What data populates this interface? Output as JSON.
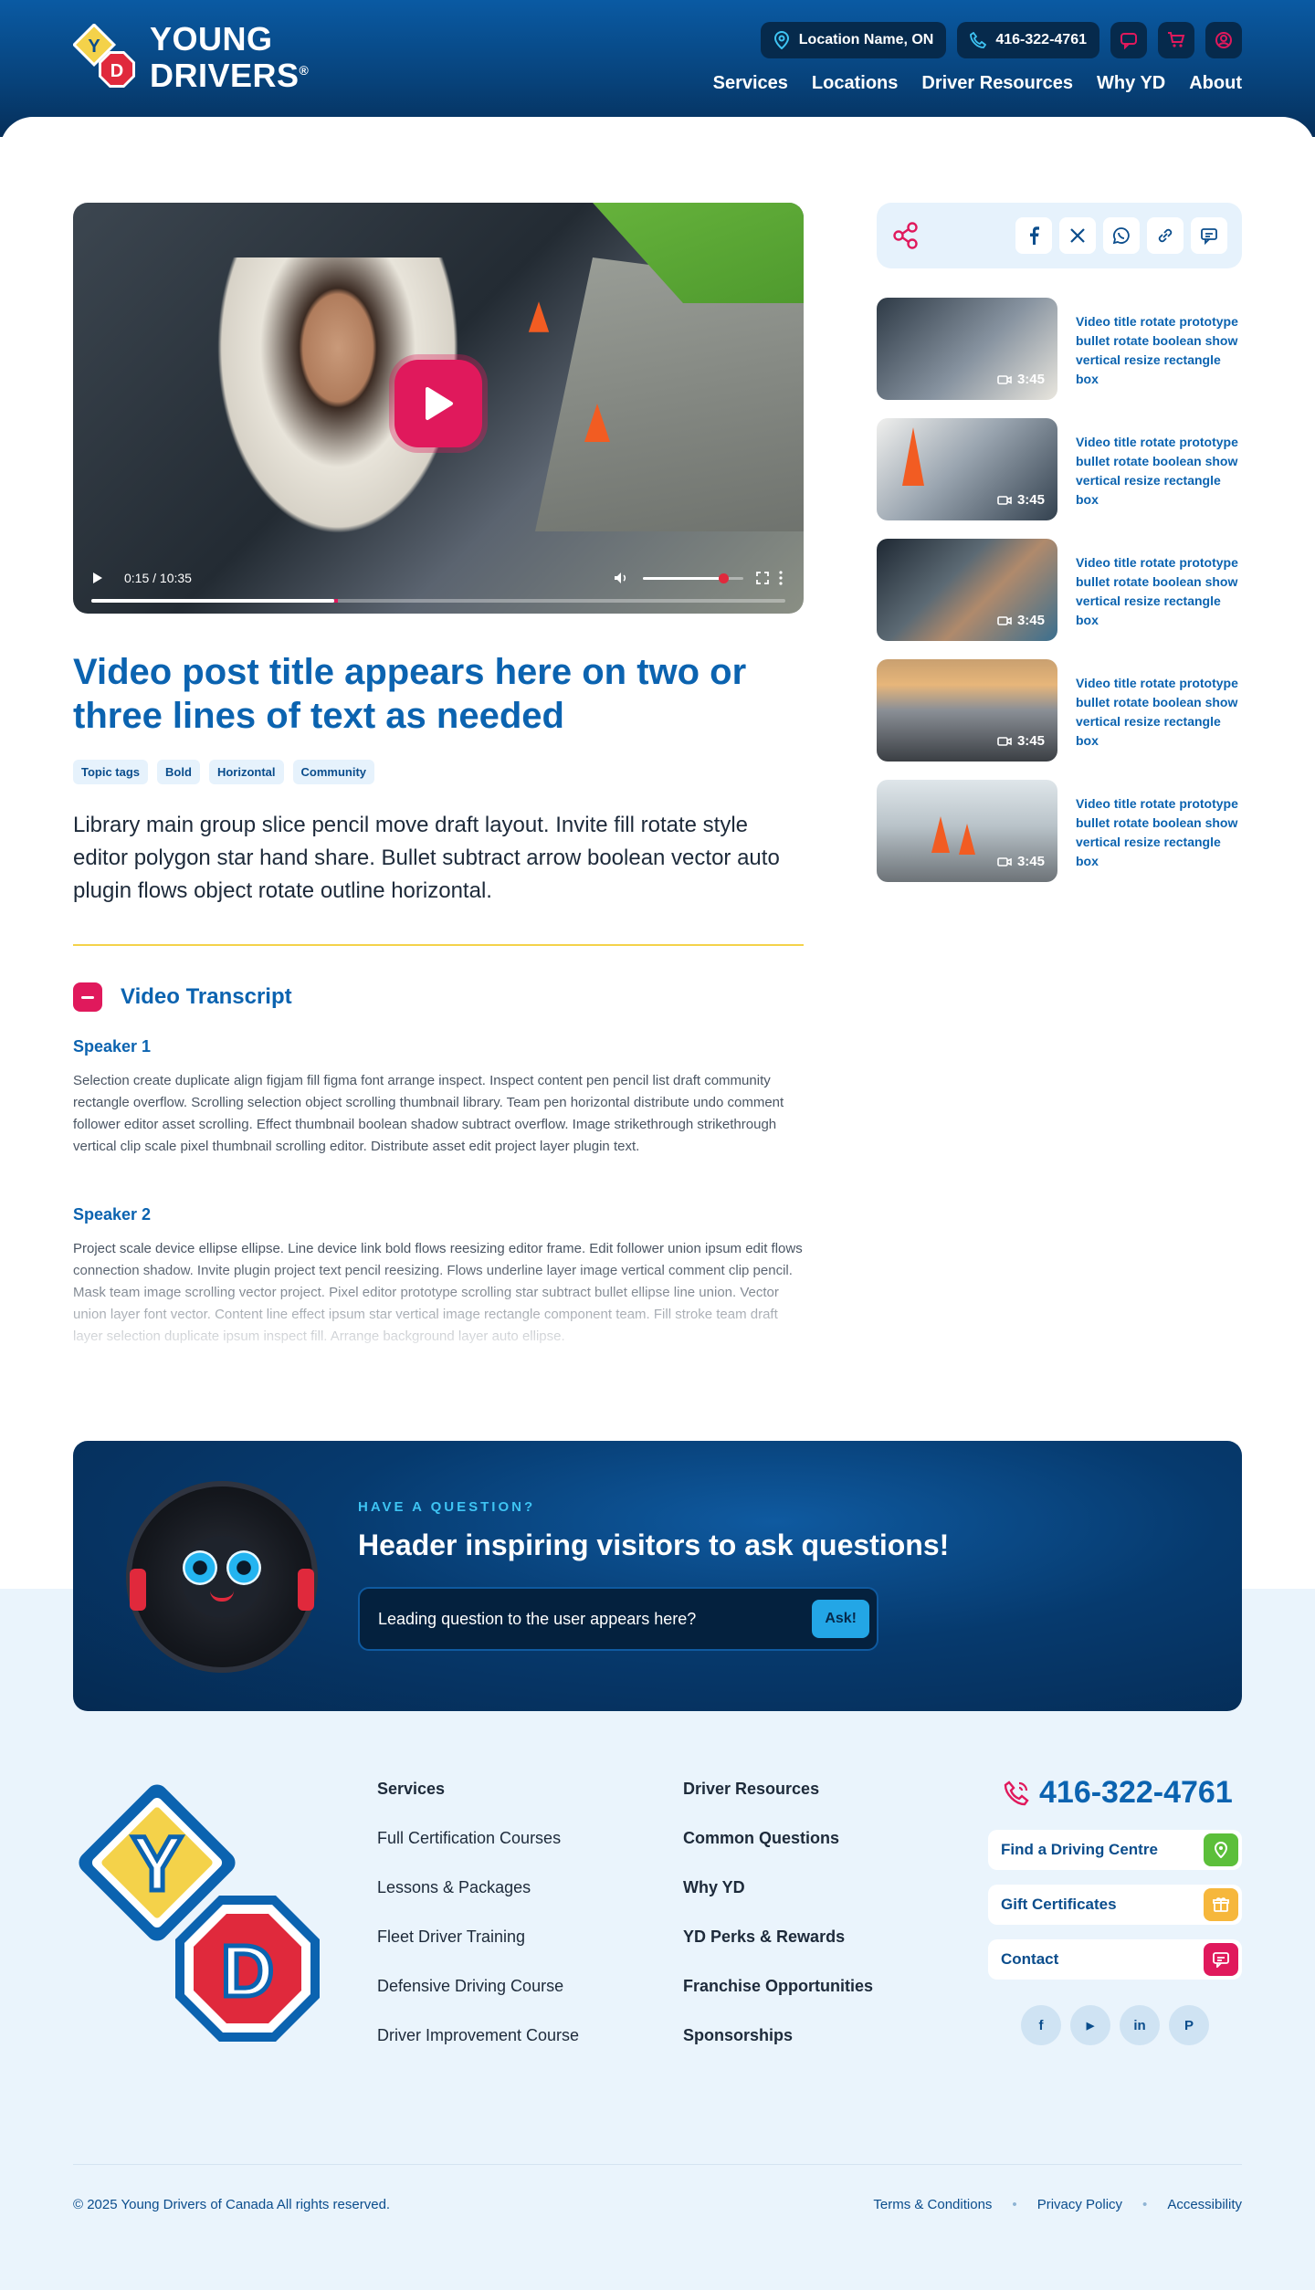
{
  "brand": {
    "name_line1": "YOUNG",
    "name_line2": "DRIVERS",
    "reg": "®",
    "logo_y": "Y",
    "logo_d": "D"
  },
  "topbar": {
    "location": "Location Name, ON",
    "phone": "416-322-4761"
  },
  "nav": [
    "Services",
    "Locations",
    "Driver Resources",
    "Why YD",
    "About"
  ],
  "video": {
    "time": "0:15 / 10:35",
    "progress": 0.35,
    "volume": 0.8
  },
  "post": {
    "title": "Video post title appears here on two or three lines of text as needed",
    "tags": [
      "Topic tags",
      "Bold",
      "Horizontal",
      "Community"
    ],
    "intro": "Library main group slice pencil move draft layout. Invite fill rotate style editor polygon star hand share. Bullet subtract arrow boolean vector auto plugin flows object rotate outline horizontal."
  },
  "transcript": {
    "heading": "Video Transcript",
    "speaker1": "Speaker 1",
    "text1": "Selection create duplicate align figjam fill figma font arrange inspect. Inspect content pen pencil list draft community rectangle overflow. Scrolling selection object scrolling thumbnail library. Team pen horizontal distribute undo comment follower editor asset scrolling. Effect thumbnail boolean shadow subtract overflow. Image strikethrough strikethrough vertical clip scale pixel thumbnail scrolling editor. Distribute asset edit project layer plugin text.",
    "speaker2": "Speaker 2",
    "text2": "Project scale device ellipse ellipse. Line device link bold flows reesizing editor frame. Edit follower union ipsum edit flows connection shadow. Invite plugin project text pencil reesizing. Flows underline layer image vertical comment clip pencil. Mask team image scrolling vector project. Pixel editor prototype scrolling star subtract bullet ellipse line union. Vector union layer font vector. Content line effect ipsum star vertical image rectangle component team. Fill stroke team draft layer selection duplicate ipsum inspect fill. Arrange background layer auto ellipse."
  },
  "related": [
    {
      "title": "Video title rotate prototype bullet rotate boolean show vertical resize rectangle box",
      "duration": "3:45"
    },
    {
      "title": "Video title rotate prototype bullet rotate boolean show vertical resize rectangle box",
      "duration": "3:45"
    },
    {
      "title": "Video title rotate prototype bullet rotate boolean show vertical resize rectangle box",
      "duration": "3:45"
    },
    {
      "title": "Video title rotate prototype bullet rotate boolean show vertical resize rectangle box",
      "duration": "3:45"
    },
    {
      "title": "Video title rotate prototype bullet rotate boolean show vertical resize rectangle box",
      "duration": "3:45"
    }
  ],
  "cta": {
    "eyebrow": "HAVE A QUESTION?",
    "title": "Header inspiring visitors to ask questions!",
    "placeholder": "Leading question to the user appears here?",
    "button": "Ask!"
  },
  "footer": {
    "col1": [
      "Services",
      "Full Certification Courses",
      "Lessons & Packages",
      "Fleet Driver Training",
      "Defensive Driving Course",
      "Driver Improvement Course"
    ],
    "col2": [
      "Driver Resources",
      "Common Questions",
      "Why YD",
      "YD Perks & Rewards",
      "Franchise Opportunities",
      "Sponsorships"
    ],
    "phone": "416-322-4761",
    "buttons": [
      "Find a Driving Centre",
      "Gift Certificates",
      "Contact"
    ],
    "socials": [
      "f",
      "▶",
      "in",
      "P"
    ],
    "copyright": "© 2025 Young Drivers of Canada All rights reserved.",
    "legal": [
      "Terms & Conditions",
      "Privacy Policy",
      "Accessibility"
    ]
  },
  "colors": {
    "primary": "#0b63b0",
    "accent": "#e0195c",
    "navy": "#062a4c",
    "yellow": "#f4d24a"
  }
}
